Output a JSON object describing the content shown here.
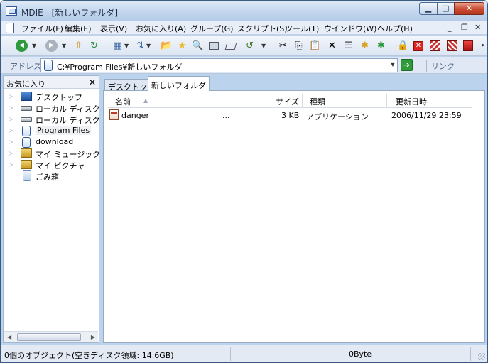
{
  "window": {
    "title": "MDIE - [新しいフォルダ]"
  },
  "window_controls": {
    "minimize": "▁",
    "maximize": "□",
    "close": "✕"
  },
  "menu": {
    "items": [
      "ファイル(F)",
      "編集(E)",
      "表示(V)",
      "お気に入り(A)",
      "グループ(G)",
      "スクリプト(S)",
      "ツール(T)",
      "ウインドウ(W)",
      "ヘルプ(H)"
    ],
    "mdi_minimize": "_",
    "mdi_restore": "❐",
    "mdi_close": "✕"
  },
  "toolbar": {
    "back_glyph": "◀",
    "forward_glyph": "▶",
    "up_glyph": "⇧",
    "refresh_glyph": "↻",
    "view_glyph": "▦",
    "sort_glyph": "⇅",
    "folder_glyph": "📂",
    "favorite_glyph": "★",
    "search_glyph": "🔍",
    "history_glyph": "↺",
    "cut_glyph": "✂",
    "copy_glyph": "⎘",
    "paste_glyph": "📋",
    "delete_glyph": "✕",
    "properties_glyph": "☰",
    "newfolder_glyph": "✱",
    "lock_glyph": "🔒",
    "more_glyph": "▸",
    "dropdown_glyph": "▼"
  },
  "address": {
    "label": "アドレス",
    "value": "C:¥Program Files¥新しいフォルダ",
    "go_glyph": "➔",
    "links_label": "リンク"
  },
  "favorites_panel": {
    "title": "お気に入り",
    "close_glyph": "✕",
    "items": [
      {
        "label": "デスクトップ",
        "icon": "desktop-icon"
      },
      {
        "label": "ローカル ディスク (C",
        "icon": "disk-icon"
      },
      {
        "label": "ローカル ディスク (D",
        "icon": "disk-icon"
      },
      {
        "label": "Program Files",
        "icon": "folder-icon"
      },
      {
        "label": "download",
        "icon": "folder-icon"
      },
      {
        "label": "マイ ミュージック",
        "icon": "music-folder-icon"
      },
      {
        "label": "マイ ピクチャ",
        "icon": "pictures-folder-icon"
      },
      {
        "label": "ごみ箱",
        "icon": "recycle-bin-icon"
      }
    ],
    "expander_glyph": "▷"
  },
  "tabs": [
    {
      "label": "デスクトップ",
      "active": false
    },
    {
      "label": "新しいフォルダ",
      "active": true
    }
  ],
  "file_list": {
    "columns": {
      "name": "名前",
      "size": "サイズ",
      "type": "種類",
      "modified": "更新日時"
    },
    "sort_glyph": "▲",
    "rows": [
      {
        "name": "danger",
        "ellipsis": "...",
        "size": "3 KB",
        "type": "アプリケーション",
        "modified": "2006/11/29 23:59",
        "icon": "application-icon"
      }
    ]
  },
  "status": {
    "objects": "0個のオブジェクト(空きディスク領域: 14.6GB)",
    "bytes": "0Byte"
  },
  "colors": {
    "titlebar": "#c3d6ee",
    "close_button": "#c84a30",
    "go_button": "#2f9a3a"
  }
}
